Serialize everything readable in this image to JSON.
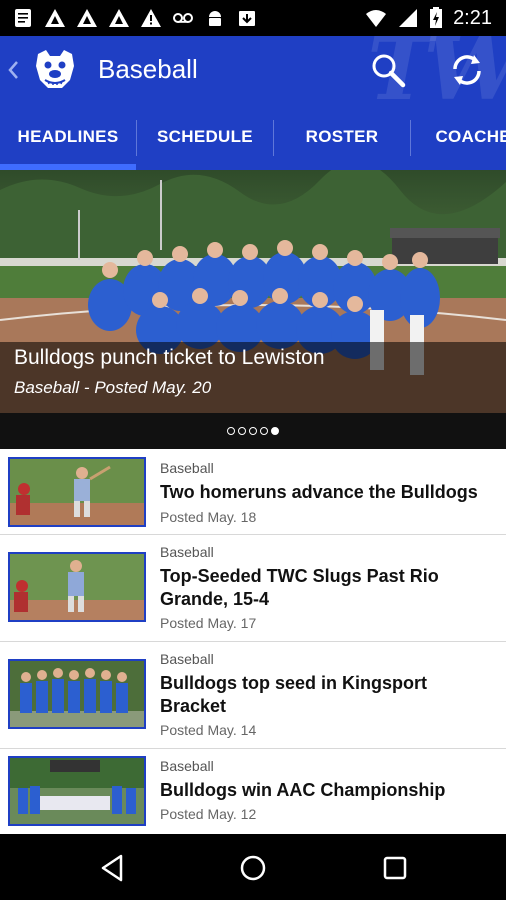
{
  "status_bar": {
    "time": "2:21",
    "left_icons": [
      "notes-icon",
      "app-icon",
      "app-icon",
      "app-icon",
      "warning-icon",
      "voicemail-icon",
      "android-icon",
      "download-icon"
    ],
    "right_icons": [
      "wifi-icon",
      "signal-icon",
      "battery-icon"
    ]
  },
  "app_bar": {
    "title": "Baseball",
    "watermark": "TW",
    "color": "#1f3fc4"
  },
  "tabs": [
    {
      "label": "HEADLINES",
      "active": true
    },
    {
      "label": "SCHEDULE",
      "active": false
    },
    {
      "label": "ROSTER",
      "active": false
    },
    {
      "label": "COACHES",
      "active": false
    }
  ],
  "hero": {
    "title": "Bulldogs punch ticket to Lewiston",
    "subtitle": "Baseball - Posted May. 20",
    "pages": 5,
    "active_page": 5
  },
  "news": [
    {
      "category": "Baseball",
      "headline": "Two homeruns advance the Bulldogs",
      "date": "Posted May. 18"
    },
    {
      "category": "Baseball",
      "headline": "Top-Seeded TWC Slugs Past Rio Grande, 15-4",
      "date": "Posted May. 17"
    },
    {
      "category": "Baseball",
      "headline": "Bulldogs top seed in Kingsport Bracket",
      "date": "Posted May. 14"
    },
    {
      "category": "Baseball",
      "headline": "Bulldogs win AAC Championship",
      "date": "Posted May. 12"
    }
  ]
}
